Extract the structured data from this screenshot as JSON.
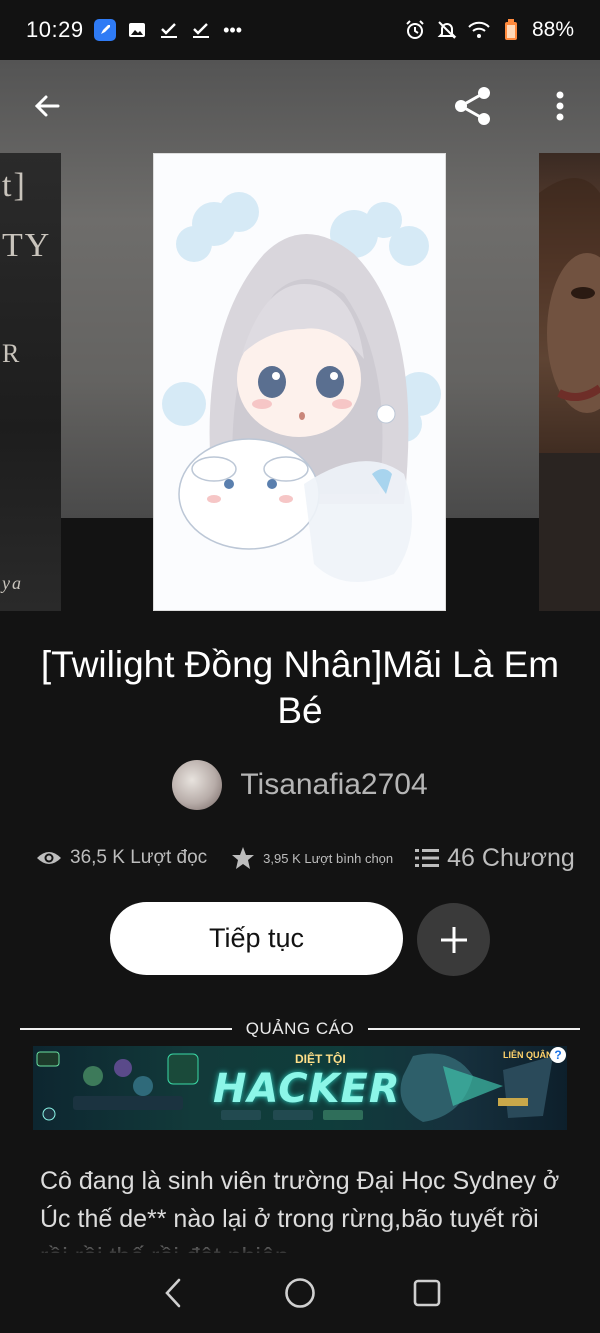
{
  "status_bar": {
    "time": "10:29",
    "battery": "88%",
    "more": "•••"
  },
  "book": {
    "title": "[Twilight Đồng Nhân]Mãi Là Em Bé",
    "author": "Tisanafia2704",
    "reads": "36,5 K Lượt đọc",
    "votes": "3,95 K Lượt bình chọn",
    "chapters": "46 Chương",
    "description": "Cô đang là sinh viên trường Đại Học Sydney ở Úc thế de** nào lại ở trong rừng,bão tuyết rồi rồi rồi thế rồi đột nhiên"
  },
  "actions": {
    "continue_label": "Tiếp tục",
    "add_label": "+"
  },
  "ad": {
    "label": "QUẢNG CÁO",
    "headline": "HACKER",
    "kicker": "DIỆT TỘI",
    "brand": "LIÊN QUÂN",
    "info": "?"
  },
  "side_covers": {
    "left_letters": [
      "t]",
      "TY",
      "R",
      "ya"
    ]
  },
  "icons": {
    "back": "arrow-left-icon",
    "share": "share-icon",
    "more": "more-vertical-icon",
    "eye": "eye-icon",
    "star": "star-icon",
    "list": "list-icon",
    "plus": "plus-icon",
    "nav_back": "nav-back-icon",
    "nav_home": "nav-home-icon",
    "nav_recents": "nav-recents-icon"
  },
  "colors": {
    "background": "#131313",
    "continue_button": "#ffffff",
    "add_button": "#3a3a3a",
    "stat_text": "#bdbdbd",
    "ad_accent": "#8cf6e8"
  }
}
